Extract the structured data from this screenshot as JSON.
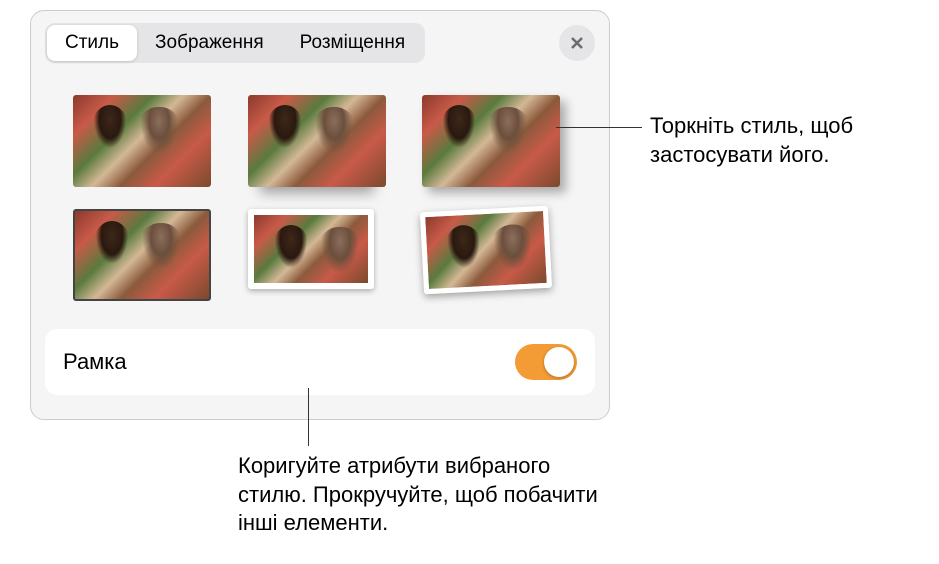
{
  "tabs": {
    "style": "Стиль",
    "image": "Зображення",
    "arrange": "Розміщення"
  },
  "section": {
    "border_label": "Рамка",
    "border_on": true
  },
  "callouts": {
    "tap_style": "Торкніть стиль, щоб застосувати його.",
    "adjust_attrs": "Коригуйте атрибути вибраного стилю. Прокручуйте, щоб побачити інші елементи."
  },
  "styles": [
    {
      "id": "plain"
    },
    {
      "id": "reflection"
    },
    {
      "id": "drop-shadow"
    },
    {
      "id": "dark-border"
    },
    {
      "id": "white-frame"
    },
    {
      "id": "polaroid-tilt"
    }
  ]
}
